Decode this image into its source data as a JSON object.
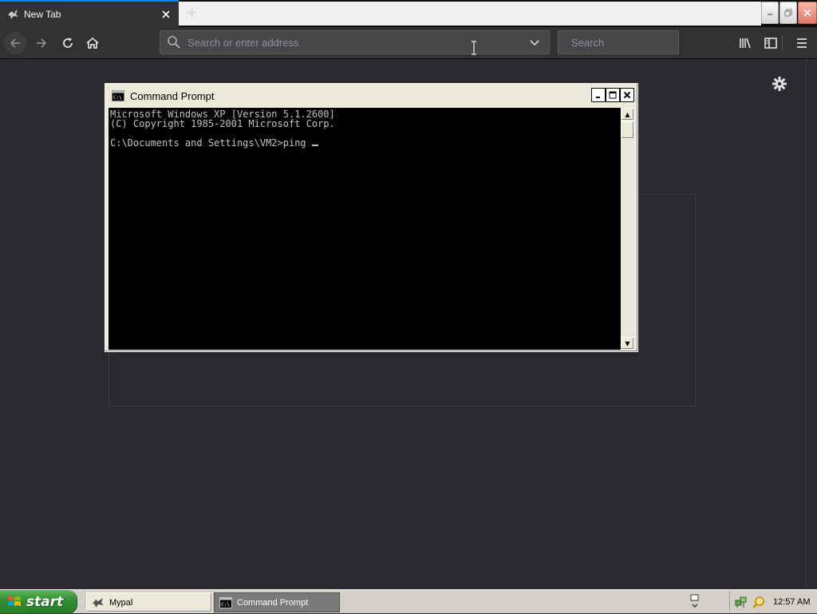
{
  "browser": {
    "tab_title": "New Tab",
    "url_placeholder": "Search or enter address",
    "search_placeholder": "Search"
  },
  "cmd": {
    "title": "Command Prompt",
    "lines": [
      "Microsoft Windows XP [Version 5.1.2600]",
      "(C) Copyright 1985-2001 Microsoft Corp.",
      "",
      "C:\\Documents and Settings\\VM2>ping "
    ]
  },
  "taskbar": {
    "start_label": "start",
    "buttons": [
      {
        "label": "Mypal",
        "icon": "mypal-icon"
      },
      {
        "label": "Command Prompt",
        "icon": "cmd-icon"
      }
    ],
    "clock": "12:57 AM"
  },
  "colors": {
    "browser_bg": "#2a2a2e",
    "toolbar": "#323234",
    "tab_accent": "#0a84ff",
    "start_green": "#2f8d2f",
    "taskbar": "#d4d0c8",
    "console_bg": "#000000",
    "console_text": "#c0c0c0"
  },
  "icons": [
    "back-arrow-icon",
    "forward-arrow-icon",
    "reload-icon",
    "home-icon",
    "search-icon",
    "chevron-down-icon",
    "library-icon",
    "sidebar-icon",
    "hamburger-menu-icon",
    "gear-icon",
    "close-icon",
    "minimize-icon",
    "maximize-icon",
    "windows-flag-icon",
    "network-icon",
    "search-tray-icon"
  ]
}
